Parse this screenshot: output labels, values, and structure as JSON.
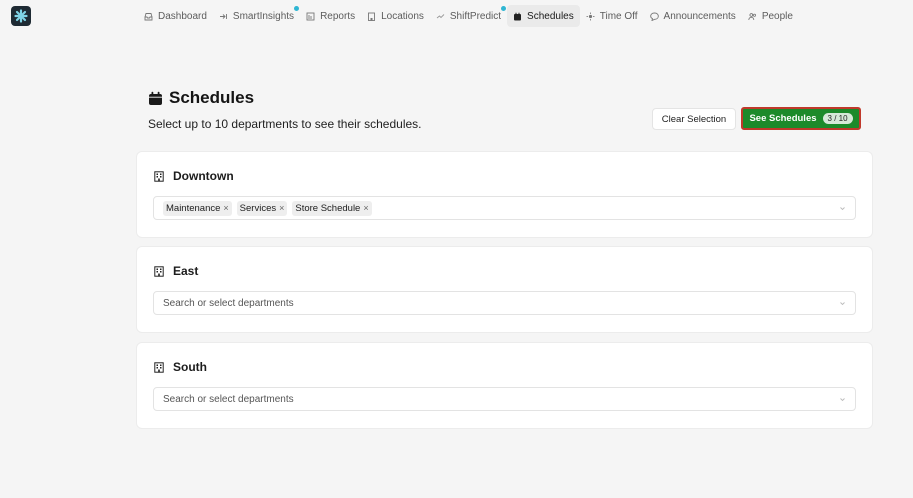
{
  "nav": {
    "items": [
      {
        "label": "Dashboard",
        "icon": "inbox-icon",
        "active": false,
        "dot": false
      },
      {
        "label": "SmartInsights",
        "icon": "arrow-in-icon",
        "active": false,
        "dot": true
      },
      {
        "label": "Reports",
        "icon": "report-icon",
        "active": false,
        "dot": false
      },
      {
        "label": "Locations",
        "icon": "building-icon",
        "active": false,
        "dot": false
      },
      {
        "label": "ShiftPredict",
        "icon": "trend-icon",
        "active": false,
        "dot": true
      },
      {
        "label": "Schedules",
        "icon": "calendar-icon",
        "active": true,
        "dot": false
      },
      {
        "label": "Time Off",
        "icon": "sun-icon",
        "active": false,
        "dot": false
      },
      {
        "label": "Announcements",
        "icon": "chat-icon",
        "active": false,
        "dot": false
      },
      {
        "label": "People",
        "icon": "people-icon",
        "active": false,
        "dot": false
      }
    ]
  },
  "header": {
    "title": "Schedules",
    "subtitle": "Select up to 10 departments to see their schedules.",
    "clear_label": "Clear Selection",
    "see_label": "See Schedules",
    "count": "3 / 10"
  },
  "locations": [
    {
      "name": "Downtown",
      "selected": [
        "Maintenance",
        "Services",
        "Store Schedule"
      ],
      "placeholder": ""
    },
    {
      "name": "East",
      "selected": [],
      "placeholder": "Search or select departments"
    },
    {
      "name": "South",
      "selected": [],
      "placeholder": "Search or select departments"
    }
  ],
  "colors": {
    "accent_green": "#1c8a2a",
    "focus_red": "#c0392b",
    "dot_blue": "#2fb6d3"
  }
}
